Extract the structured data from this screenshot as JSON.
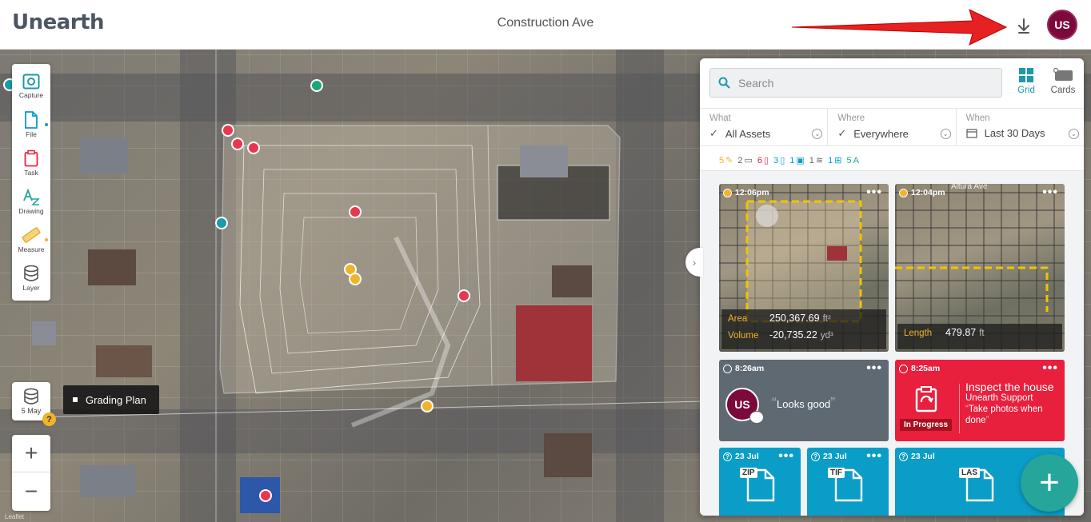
{
  "app": {
    "logo": "Unearth",
    "project": "Construction Ave",
    "user_initials": "US"
  },
  "map": {
    "attribution": "Leaflet",
    "layer_date": "5 May",
    "grading_label": "Grading Plan",
    "help_badge": "?"
  },
  "toolbar": [
    {
      "label": "Capture",
      "icon": "capture-icon"
    },
    {
      "label": "File",
      "icon": "file-icon"
    },
    {
      "label": "Task",
      "icon": "task-icon"
    },
    {
      "label": "Drawing",
      "icon": "drawing-icon"
    },
    {
      "label": "Measure",
      "icon": "measure-icon"
    },
    {
      "label": "Layer",
      "icon": "layer-icon"
    }
  ],
  "zoom": {
    "in": "+",
    "out": "−"
  },
  "panel": {
    "search_placeholder": "Search",
    "views": [
      {
        "label": "Grid"
      },
      {
        "label": "Cards"
      }
    ],
    "filters": [
      {
        "heading": "What",
        "value": "All Assets"
      },
      {
        "heading": "Where",
        "value": "Everywhere"
      },
      {
        "heading": "When",
        "value": "Last 30 Days"
      }
    ],
    "counts": [
      "5",
      "2",
      "6",
      "3",
      "1",
      "1",
      "1",
      "5"
    ],
    "cards": [
      {
        "time": "12:06pm",
        "area_label": "Area",
        "area_value": "250,367.69",
        "area_unit": "ft²",
        "volume_label": "Volume",
        "volume_value": "-20,735.22",
        "volume_unit": "yd³"
      },
      {
        "time": "12:04pm",
        "length_label": "Length",
        "length_value": "479.87",
        "length_unit": "ft",
        "map_label": "Altura Ave"
      },
      {
        "time": "8:26am",
        "avatar": "US",
        "comment": "Looks good"
      },
      {
        "time": "8:25am",
        "title": "Inspect the house",
        "author": "Unearth Support",
        "note": "Take photos when done",
        "status": "In Progress"
      },
      {
        "time": "23 Jul",
        "ext": "ZIP"
      },
      {
        "time": "23 Jul",
        "ext": "TIF"
      },
      {
        "time": "23 Jul",
        "ext": "LAS"
      }
    ],
    "more": "•••",
    "fab": "+"
  },
  "colors": {
    "teal": "#26a69a",
    "primary": "#1b9aaa",
    "task_red": "#e8203d",
    "comment_gray": "#5f6971",
    "file_blue": "#0a9dc7",
    "brand": "#7b0a3a"
  }
}
